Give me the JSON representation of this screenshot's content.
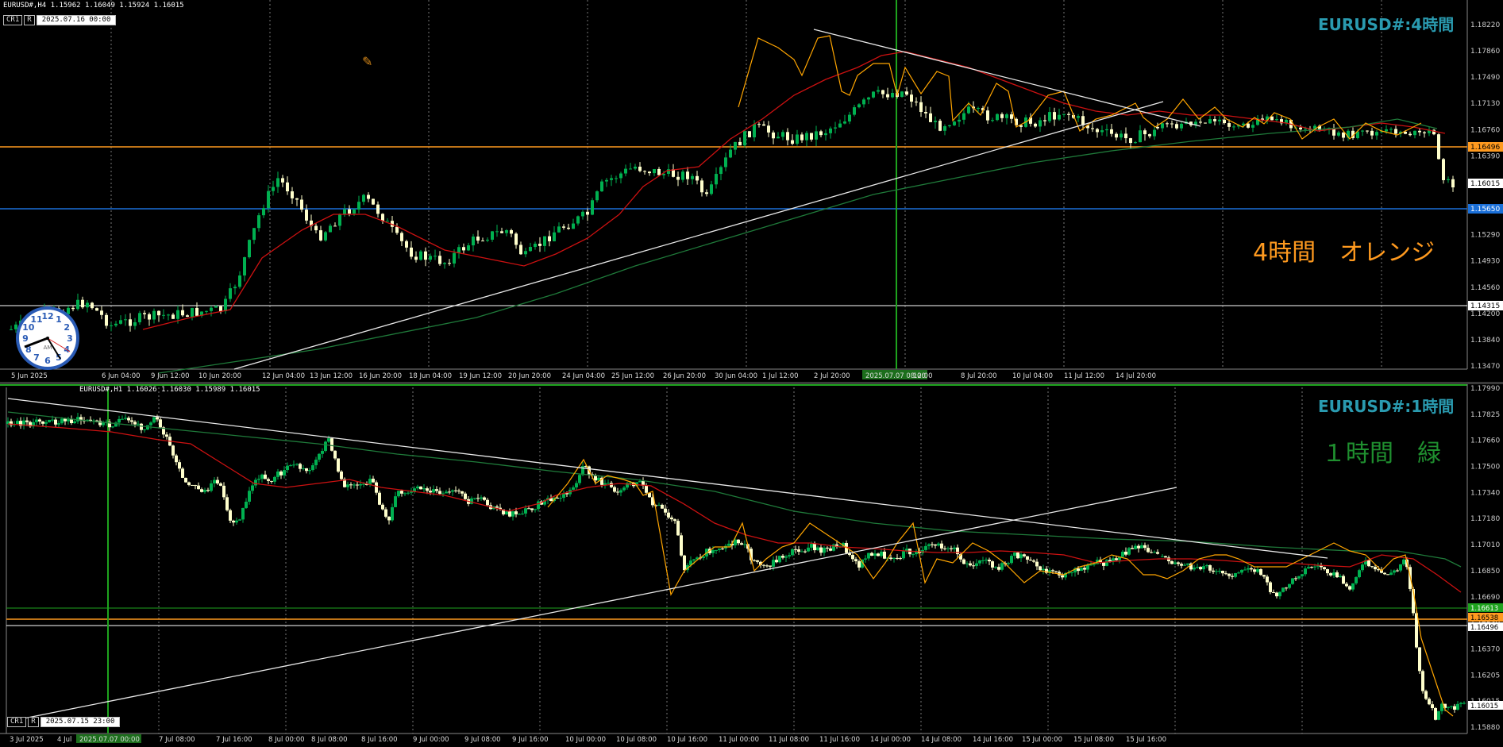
{
  "top_chart": {
    "info": "EURUSD#,H4  1.15962 1.16049 1.15924 1.16015",
    "btn_cr1": "CR1",
    "btn_r": "R",
    "datetime": "2025.07.16 00:00",
    "title": "EURUSD#:4時間",
    "annotation": "4時間　オレンジ",
    "price_labels": [
      "1.18220",
      "1.17860",
      "1.17490",
      "1.17130",
      "1.16760",
      "1.16390",
      "1.16015",
      "1.15650",
      "1.15290",
      "1.14930",
      "1.14560",
      "1.14200",
      "1.13840",
      "1.13470"
    ],
    "level_labels": {
      "orange": "1.16496",
      "blue": "1.15650",
      "white": "1.14315",
      "price": "1.16015"
    },
    "time_labels": [
      "5 Jun 2025",
      "6 Jun 04:00",
      "9 Jun 12:00",
      "10 Jun 20:00",
      "12 Jun 04:00",
      "13 Jun 12:00",
      "16 Jun 20:00",
      "18 Jun 04:00",
      "19 Jun 12:00",
      "20 Jun 20:00",
      "24 Jun 04:00",
      "25 Jun 12:00",
      "26 Jun 20:00",
      "30 Jun 04:00",
      "1 Jul 12:00",
      "2 Jul 20:00",
      "2025.07.07 08:00",
      "12:00",
      "8 Jul 20:00",
      "10 Jul 04:00",
      "11 Jul 12:00",
      "14 Jul 20:00"
    ]
  },
  "bottom_chart": {
    "info": "EURUSD#,H1  1.16026 1.16030 1.15989 1.16015",
    "btn_cr1": "CR1",
    "btn_r": "R",
    "datetime": "2025.07.15 23:00",
    "title": "EURUSD#:1時間",
    "annotation": "１時間　緑",
    "price_labels": [
      "1.17990",
      "1.17825",
      "1.17660",
      "1.17500",
      "1.17340",
      "1.17180",
      "1.17010",
      "1.16850",
      "1.16690",
      "1.16530",
      "1.16370",
      "1.16205",
      "1.16015",
      "1.15880"
    ],
    "level_labels": {
      "green": "1.16613",
      "orange": "1.16538",
      "white": "1.16496",
      "price": "1.16015"
    },
    "time_labels": [
      "3 Jul 2025",
      "4 Jul",
      "2025.07.07 00:00",
      "7 Jul 08:00",
      "7 Jul 16:00",
      "8 Jul 00:00",
      "8 Jul 08:00",
      "8 Jul 16:00",
      "9 Jul 00:00",
      "9 Jul 08:00",
      "9 Jul 16:00",
      "10 Jul 00:00",
      "10 Jul 08:00",
      "10 Jul 16:00",
      "11 Jul 00:00",
      "11 Jul 08:00",
      "11 Jul 16:00",
      "14 Jul 00:00",
      "14 Jul 08:00",
      "14 Jul 16:00",
      "15 Jul 00:00",
      "15 Jul 08:00",
      "15 Jul 16:00"
    ]
  },
  "clock": {
    "am_label": "AM",
    "numbers": [
      "12",
      "1",
      "2",
      "3",
      "4",
      "5",
      "6",
      "7",
      "8",
      "9",
      "10",
      "11"
    ]
  },
  "colors": {
    "bull": "#00b050",
    "bear": "#ffffcc",
    "ma_red": "#cc1111",
    "ma_green": "#1f7a3a",
    "zigzag": "#ffa500",
    "title": "#2a9bb0",
    "orange_text": "#ff9a1f",
    "green_text": "#1f8f2f",
    "grid": "#777777"
  }
}
